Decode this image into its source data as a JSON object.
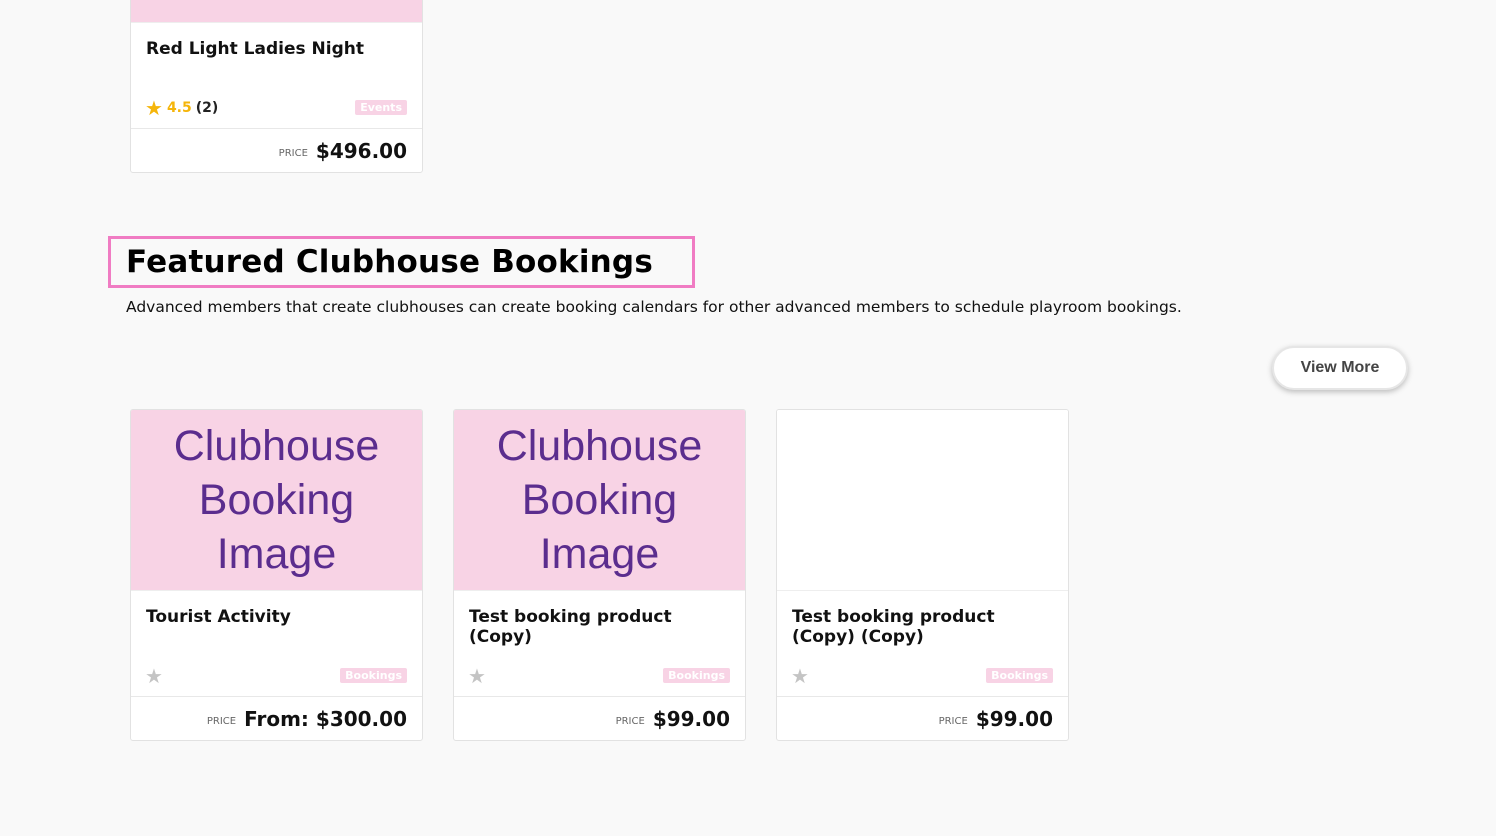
{
  "top_card": {
    "image_text_fragment": "",
    "title": "Red Light Ladies Night",
    "rating_value": "4.5",
    "rating_count": "(2)",
    "badge": "Events",
    "price_label": "PRICE",
    "price": "$496.00"
  },
  "section": {
    "title": "Featured Clubhouse Bookings",
    "description": "Advanced members that create clubhouses can create booking calendars for other advanced members to schedule playroom bookings.",
    "view_more_label": "View More"
  },
  "placeholder_image_lines": [
    "Clubhouse",
    "Booking",
    "Image"
  ],
  "cards": [
    {
      "title": "Tourist Activity",
      "badge": "Bookings",
      "price_label": "PRICE",
      "price": "From: $300.00",
      "has_image": true
    },
    {
      "title": "Test booking product (Copy)",
      "badge": "Bookings",
      "price_label": "PRICE",
      "price": "$99.00",
      "has_image": true
    },
    {
      "title": "Test booking product (Copy) (Copy)",
      "badge": "Bookings",
      "price_label": "PRICE",
      "price": "$99.00",
      "has_image": false
    }
  ],
  "icons": {
    "star_filled": "star-filled-icon",
    "star_empty": "star-empty-icon"
  },
  "colors": {
    "accent_pink": "#f8d3e5",
    "highlight_border": "#f07cc3",
    "image_text_purple": "#5b2d8e",
    "star_gold": "#f5b50a"
  }
}
